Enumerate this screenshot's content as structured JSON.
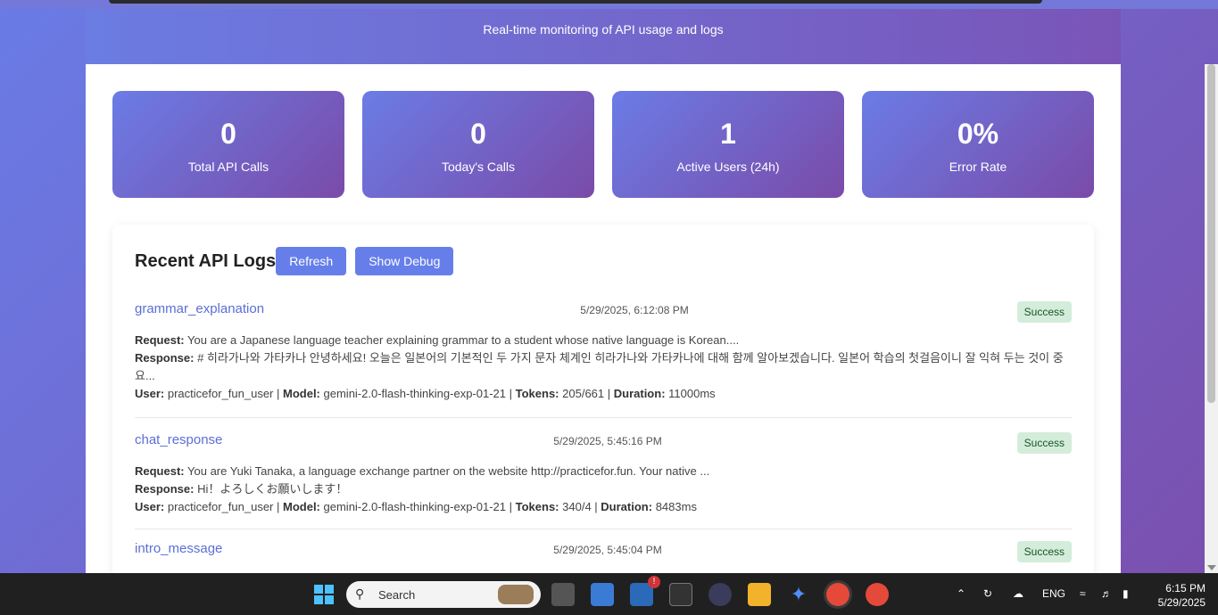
{
  "header": {
    "subtitle": "Real-time monitoring of API usage and logs"
  },
  "stats": [
    {
      "value": "0",
      "label": "Total API Calls"
    },
    {
      "value": "0",
      "label": "Today's Calls"
    },
    {
      "value": "1",
      "label": "Active Users (24h)"
    },
    {
      "value": "0%",
      "label": "Error Rate"
    }
  ],
  "logs": {
    "title": "Recent API Logs",
    "refresh_label": "Refresh",
    "debug_label": "Show Debug",
    "field_labels": {
      "request": "Request:",
      "response": "Response:",
      "user": "User:",
      "model": "Model:",
      "tokens": "Tokens:",
      "duration": "Duration:"
    },
    "entries": [
      {
        "type": "grammar_explanation",
        "time": "5/29/2025, 6:12:08 PM",
        "status": "Success",
        "request": "You are a Japanese language teacher explaining grammar to a student whose native language is Korean....",
        "response": "# 히라가나와 가타카나 안녕하세요! 오늘은 일본어의 기본적인 두 가지 문자 체계인 히라가나와 가타카나에 대해 함께 알아보겠습니다. 일본어 학습의 첫걸음이니 잘 익혀 두는 것이 중요...",
        "user": "practicefor_fun_user",
        "model": "gemini-2.0-flash-thinking-exp-01-21",
        "tokens": "205/661",
        "duration": "11000ms"
      },
      {
        "type": "chat_response",
        "time": "5/29/2025, 5:45:16 PM",
        "status": "Success",
        "request": "You are Yuki Tanaka, a language exchange partner on the website http://practicefor.fun. Your native ...",
        "response": "Hi！よろしくお願いします！",
        "user": "practicefor_fun_user",
        "model": "gemini-2.0-flash-thinking-exp-01-21",
        "tokens": "340/4",
        "duration": "8483ms"
      },
      {
        "type": "intro_message",
        "time": "5/29/2025, 5:45:04 PM",
        "status": "Success"
      }
    ]
  },
  "taskbar": {
    "search_placeholder": "Search",
    "language": "ENG",
    "time": "6:15 PM",
    "date": "5/29/2025",
    "notification_badge": "!"
  },
  "colors": {
    "accent": "#667eea",
    "gradient_start": "#6a7be6",
    "gradient_end": "#7b4fae",
    "success_bg": "#d4edda",
    "success_text": "#155724"
  }
}
